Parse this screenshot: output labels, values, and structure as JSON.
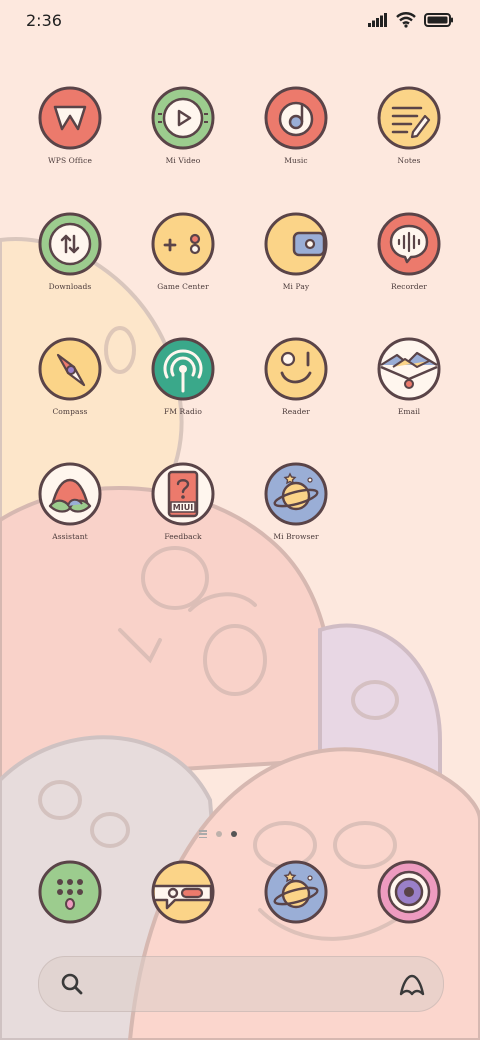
{
  "status_bar": {
    "time": "2:36"
  },
  "apps": [
    {
      "label": "WPS Office",
      "icon": "wps-office-icon"
    },
    {
      "label": "Mi Video",
      "icon": "mi-video-icon"
    },
    {
      "label": "Music",
      "icon": "music-icon"
    },
    {
      "label": "Notes",
      "icon": "notes-icon"
    },
    {
      "label": "Downloads",
      "icon": "downloads-icon"
    },
    {
      "label": "Game Center",
      "icon": "game-center-icon"
    },
    {
      "label": "Mi Pay",
      "icon": "mi-pay-icon"
    },
    {
      "label": "Recorder",
      "icon": "recorder-icon"
    },
    {
      "label": "Compass",
      "icon": "compass-icon"
    },
    {
      "label": "FM Radio",
      "icon": "fm-radio-icon"
    },
    {
      "label": "Reader",
      "icon": "reader-icon"
    },
    {
      "label": "Email",
      "icon": "email-icon"
    },
    {
      "label": "Assistant",
      "icon": "assistant-icon"
    },
    {
      "label": "Feedback",
      "icon": "feedback-icon"
    },
    {
      "label": "Mi Browser",
      "icon": "mi-browser-icon"
    }
  ],
  "feedback_badge": "MIUI",
  "dock": [
    {
      "icon": "phone-dialer-icon"
    },
    {
      "icon": "messages-icon"
    },
    {
      "icon": "browser-planet-icon"
    },
    {
      "icon": "camera-icon"
    }
  ],
  "page_indicator": {
    "pages": 2,
    "current": 2
  },
  "colors": {
    "background": "#fde5da",
    "outline": "#5a4448",
    "red": "#ec7a6c",
    "green": "#9ccc8e",
    "yellow": "#fbd488",
    "blue": "#9aaed6",
    "teal": "#3aa88a",
    "pink": "#ee9bc0"
  }
}
